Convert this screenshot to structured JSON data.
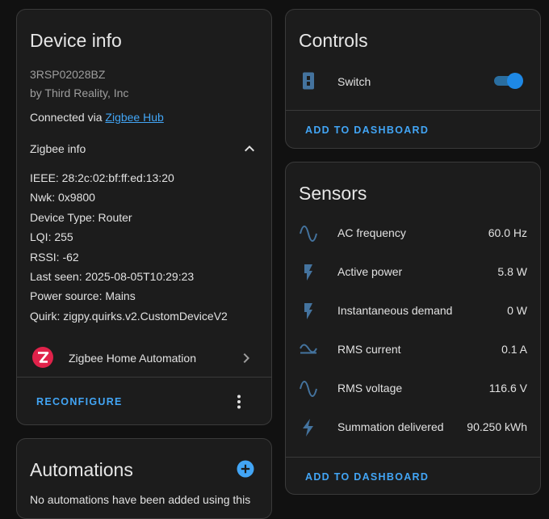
{
  "device_info": {
    "title": "Device info",
    "model": "3RSP02028BZ",
    "manufacturer": "by Third Reality, Inc",
    "connected_prefix": "Connected via ",
    "connected_link": "Zigbee Hub",
    "zigbee_section_title": "Zigbee info",
    "zigbee_details": [
      "IEEE: 28:2c:02:bf:ff:ed:13:20",
      "Nwk: 0x9800",
      "Device Type: Router",
      "LQI: 255",
      "RSSI: -62",
      "Last seen: 2025-08-05T10:29:23",
      "Power source: Mains",
      "Quirk: zigpy.quirks.v2.CustomDeviceV2"
    ],
    "integration_label": "Zigbee Home Automation",
    "reconfigure_label": "RECONFIGURE"
  },
  "automations": {
    "title": "Automations",
    "empty_text": "No automations have been added using this"
  },
  "controls": {
    "title": "Controls",
    "items": [
      {
        "name": "Switch",
        "icon": "power-socket-icon",
        "state": "on"
      }
    ],
    "add_label": "ADD TO DASHBOARD"
  },
  "sensors": {
    "title": "Sensors",
    "items": [
      {
        "name": "AC frequency",
        "value": "60.0 Hz",
        "icon": "sine-wave-icon"
      },
      {
        "name": "Active power",
        "value": "5.8 W",
        "icon": "flash-icon"
      },
      {
        "name": "Instantaneous demand",
        "value": "0 W",
        "icon": "flash-icon"
      },
      {
        "name": "RMS current",
        "value": "0.1 A",
        "icon": "current-ac-icon"
      },
      {
        "name": "RMS voltage",
        "value": "116.6 V",
        "icon": "sine-wave-icon"
      },
      {
        "name": "Summation delivered",
        "value": "90.250 kWh",
        "icon": "lightning-icon"
      }
    ],
    "add_label": "ADD TO DASHBOARD"
  },
  "colors": {
    "accent": "#42a5f5",
    "icon": "#44739e",
    "zha_red": "#e0224a",
    "card": "#1c1c1c",
    "background": "#111111"
  }
}
